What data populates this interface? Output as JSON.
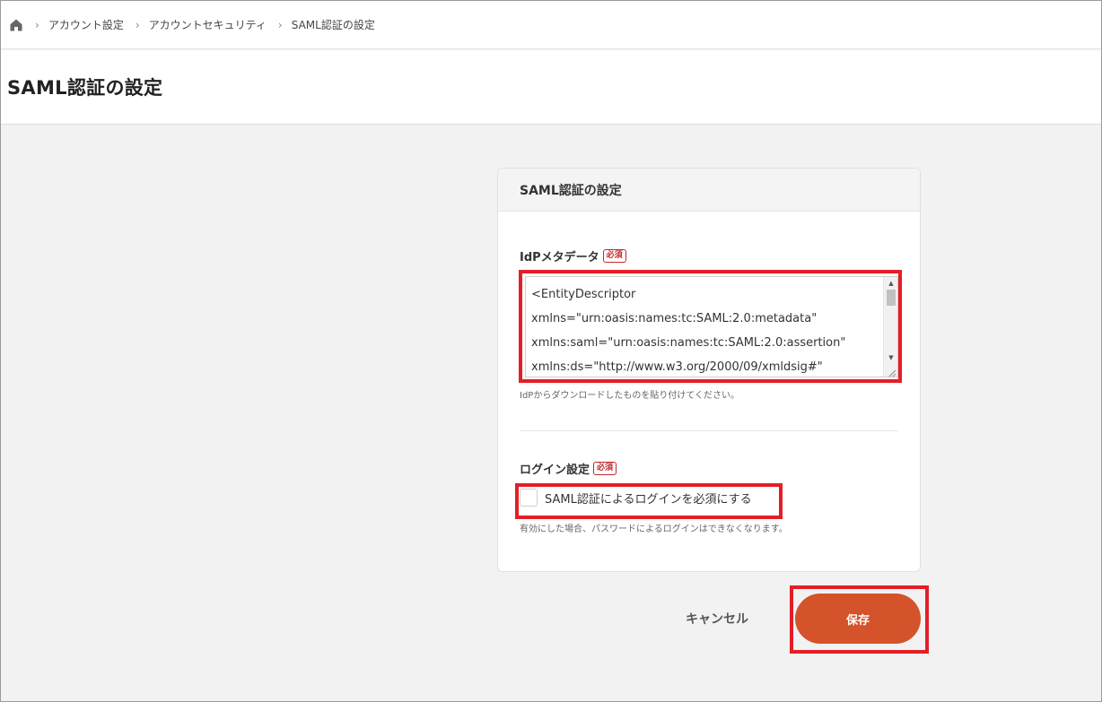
{
  "breadcrumb": {
    "home_icon": "home-icon",
    "items": [
      "アカウント設定",
      "アカウントセキュリティ",
      "SAML認証の設定"
    ]
  },
  "page": {
    "title": "SAML認証の設定"
  },
  "card": {
    "title": "SAML認証の設定",
    "idp_metadata": {
      "label": "IdPメタデータ",
      "required_badge": "必須",
      "lines": [
        "<EntityDescriptor",
        "xmlns=\"urn:oasis:names:tc:SAML:2.0:metadata\"",
        "xmlns:saml=\"urn:oasis:names:tc:SAML:2.0:assertion\"",
        "xmlns:ds=\"http://www.w3.org/2000/09/xmldsig#\""
      ],
      "help": "IdPからダウンロードしたものを貼り付けてください。"
    },
    "login_setting": {
      "label": "ログイン設定",
      "required_badge": "必須",
      "checkbox_label": "SAML認証によるログインを必須にする",
      "checked": false,
      "help": "有効にした場合、パスワードによるログインはできなくなります。"
    }
  },
  "actions": {
    "cancel_label": "キャンセル",
    "save_label": "保存"
  },
  "colors": {
    "accent": "#d4532a",
    "highlight": "#e41e26",
    "required": "#c0272d"
  }
}
